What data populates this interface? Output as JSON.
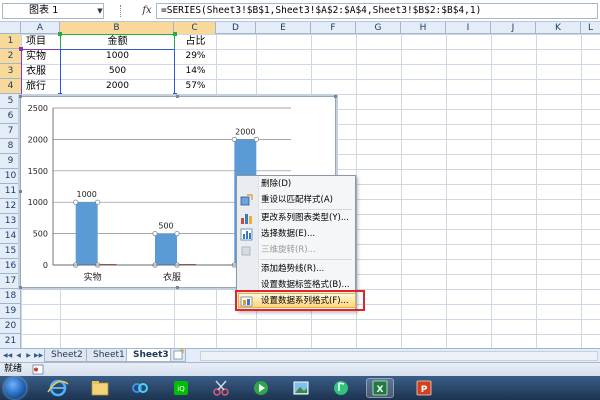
{
  "formula_bar": {
    "name_box": "图表 1",
    "fx_label": "fx",
    "formula": "=SERIES(Sheet3!$B$1,Sheet3!$A$2:$A$4,Sheet3!$B$2:$B$4,1)"
  },
  "columns": [
    "A",
    "B",
    "C",
    "D",
    "E",
    "F",
    "G",
    "H",
    "I",
    "J",
    "K",
    "L"
  ],
  "rows": [
    "1",
    "2",
    "3",
    "4",
    "5",
    "6",
    "7",
    "8",
    "9",
    "10",
    "11",
    "12",
    "13",
    "14",
    "15",
    "16",
    "17",
    "18",
    "19",
    "20",
    "21",
    "22",
    "23"
  ],
  "cells": {
    "A1": "项目",
    "B1": "金额",
    "C1": "占比",
    "A2": "实物",
    "B2": "1000",
    "C2": "29%",
    "A3": "衣服",
    "B3": "500",
    "C3": "14%",
    "A4": "旅行",
    "B4": "2000",
    "C4": "57%"
  },
  "chart_data": {
    "type": "bar",
    "categories": [
      "实物",
      "衣服",
      "旅行"
    ],
    "visible_category_labels": [
      "实物",
      "衣服"
    ],
    "series": [
      {
        "name": "金额",
        "values": [
          1000,
          500,
          2000
        ],
        "color": "#5b9bd5"
      },
      {
        "name": "占比",
        "values": [
          0.29,
          0.14,
          0.57
        ],
        "color": "#c0504d"
      }
    ],
    "data_labels": [
      "1000",
      "500",
      "2000"
    ],
    "yticks": [
      "0",
      "500",
      "1000",
      "1500",
      "2000",
      "2500"
    ],
    "ylim": [
      0,
      2500
    ],
    "grid": true,
    "selected_series": "金额"
  },
  "context_menu": {
    "items": [
      {
        "label": "删除(D)",
        "disabled": false,
        "icon": ""
      },
      {
        "label": "重设以匹配样式(A)",
        "disabled": false,
        "icon": "reset-style-icon"
      },
      {
        "label": "更改系列图表类型(Y)...",
        "disabled": false,
        "icon": "chart-type-icon"
      },
      {
        "label": "选择数据(E)...",
        "disabled": false,
        "icon": "select-data-icon"
      },
      {
        "label": "三维旋转(R)...",
        "disabled": true,
        "icon": "rotate-3d-icon"
      },
      {
        "label": "添加趋势线(R)...",
        "disabled": false,
        "icon": ""
      },
      {
        "label": "设置数据标签格式(B)...",
        "disabled": false,
        "icon": ""
      },
      {
        "label": "设置数据系列格式(F)...",
        "disabled": false,
        "icon": "format-series-icon",
        "highlighted": true
      }
    ]
  },
  "sheet_tabs": {
    "tabs": [
      "Sheet2",
      "Sheet1",
      "Sheet3"
    ],
    "active": "Sheet3"
  },
  "status_bar": {
    "text": "就绪"
  },
  "taskbar": {
    "icons": [
      "start-orb-icon",
      "internet-explorer-icon",
      "file-explorer-icon",
      "baidu-netdisk-icon",
      "iqiyi-icon",
      "scissors-icon",
      "media-player-icon",
      "photos-icon",
      "qq-music-icon",
      "app-icon",
      "excel-icon",
      "powerpoint-icon"
    ]
  }
}
